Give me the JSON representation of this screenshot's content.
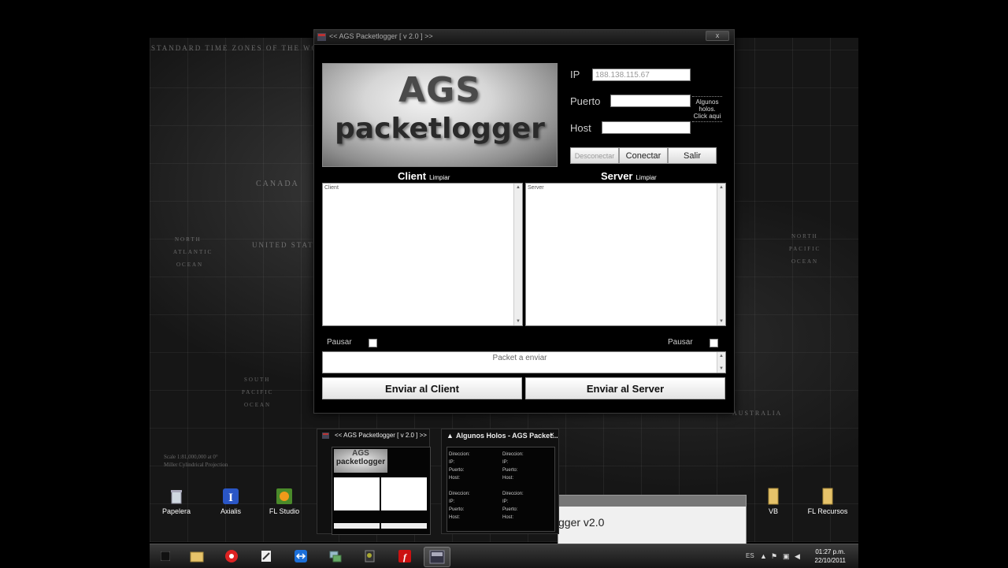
{
  "wallpaper": {
    "map_title": "STANDARD TIME ZONES OF THE WORLD",
    "labels": [
      "CANADA",
      "UNITED STATES",
      "NORTH",
      "ATLANTIC",
      "OCEAN",
      "NORTH",
      "PACIFIC",
      "OCEAN",
      "SOUTH",
      "PACIFIC",
      "OCEAN",
      "AUSTRALIA",
      "Scale 1:81,000,000 at 0°",
      "Miller Cylindrical Projection"
    ]
  },
  "desktop_icons": [
    {
      "label": "Papelera",
      "icon": "recycle-bin-icon"
    },
    {
      "label": "Axialis",
      "icon": "axialis-icon"
    },
    {
      "label": "FL Studio",
      "icon": "fl-studio-icon"
    },
    {
      "label": "VB",
      "icon": "folder-icon"
    },
    {
      "label": "FL Recursos",
      "icon": "folder-icon"
    }
  ],
  "window": {
    "title": "<< AGS Packetlogger [ v 2.0 ] >>",
    "close_label": "x",
    "logo_line1": "AGS",
    "logo_line2": "packetlogger",
    "ip_label": "IP",
    "ip_value": "188.138.115.67",
    "port_label": "Puerto",
    "port_value": "",
    "host_label": "Host",
    "host_value": "",
    "holos_link": "Algunos holos. Click aqui",
    "disconnect_label": "Desconectar",
    "connect_label": "Conectar",
    "exit_label": "Salir",
    "client_title": "Client",
    "client_clear": "Limpiar",
    "client_text": "Client",
    "server_title": "Server",
    "server_clear": "Limpiar",
    "server_text": "Server",
    "pause_label": "Pausar",
    "packet_placeholder": "Packet a enviar",
    "send_client_label": "Enviar al Client",
    "send_server_label": "Enviar al Server"
  },
  "previews": {
    "packetlogger_title": "<< AGS Packetlogger [ v 2.0 ] >>",
    "packetlogger_logo1": "AGS",
    "packetlogger_logo2": "packetlogger",
    "holos_title": "Algunos Holos - AGS Packet...",
    "holos_close": "×",
    "holos_labels": [
      "Direccion:",
      "IP:",
      "Puerto:",
      "Host:"
    ]
  },
  "background_window": {
    "text": "gger v2.0"
  },
  "taskbar": {
    "language": "ES",
    "time": "01:27 p.m.",
    "date": "22/10/2011",
    "apps": [
      "folder-icon",
      "browser-icon",
      "notepad-icon",
      "teamviewer-icon",
      "network-icon",
      "video-icon",
      "flash-icon",
      "ags-icon"
    ]
  }
}
